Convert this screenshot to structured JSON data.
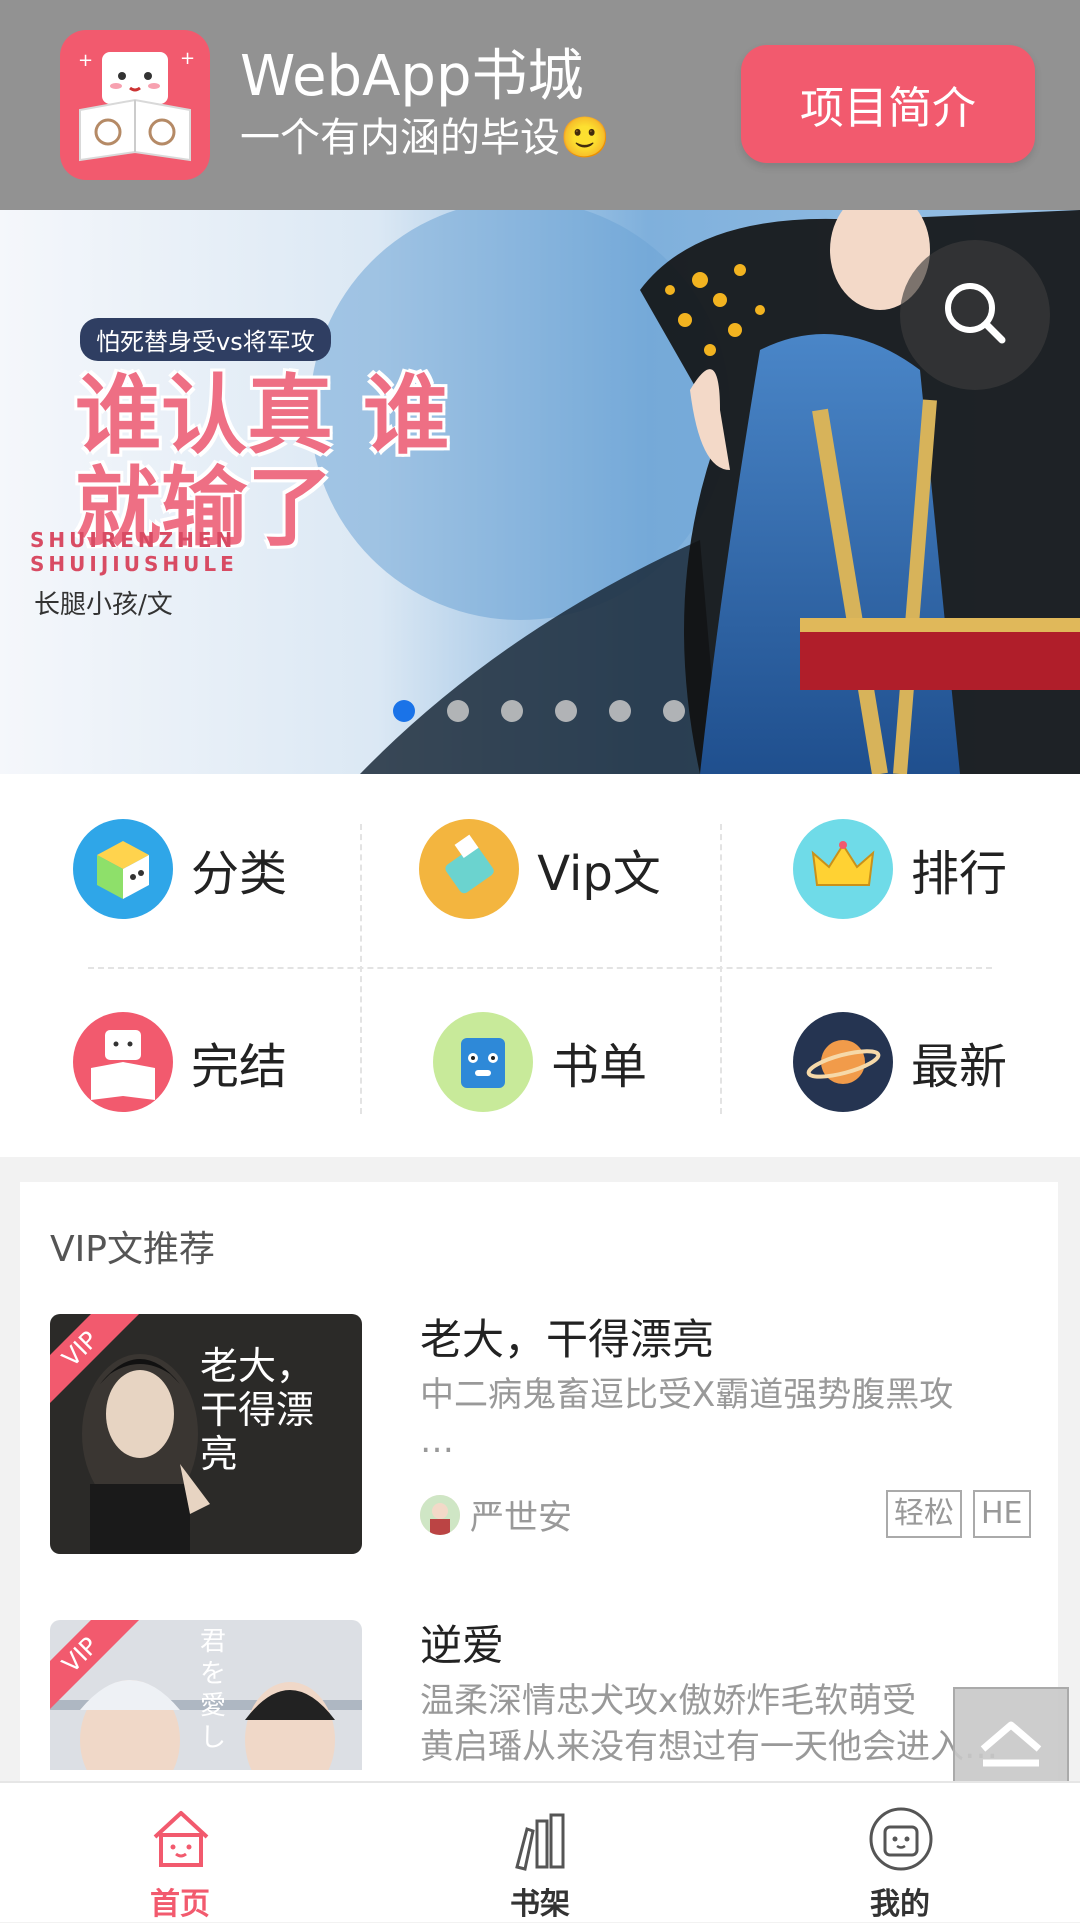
{
  "topbar": {
    "app_title": "WebApp书城",
    "app_subtitle": "一个有内涵的毕设🙂",
    "intro_button": "项目简介"
  },
  "banner": {
    "tag": "怕死替身受vs将军攻",
    "title": "谁认真 谁就输了",
    "pinyin": "SHUIRENZHEN SHUIJIUSHULE",
    "author": "长腿小孩/文",
    "slide_count": 6,
    "active_slide": 1
  },
  "categories": [
    {
      "label": "分类",
      "icon": "cube-icon"
    },
    {
      "label": "Vip文",
      "icon": "usb-drive-icon"
    },
    {
      "label": "排行",
      "icon": "crown-icon"
    },
    {
      "label": "完结",
      "icon": "bookstore-mascot-icon"
    },
    {
      "label": "书单",
      "icon": "blue-book-monster-icon"
    },
    {
      "label": "最新",
      "icon": "planet-icon"
    }
  ],
  "vip_section": {
    "title": "VIP文推荐",
    "vip_label": "VIP",
    "books": [
      {
        "title": "老大，干得漂亮",
        "desc": "中二病鬼畜逗比受X霸道强势腹黑攻",
        "desc_line2": "…",
        "author": "严世安",
        "tags": [
          "轻松",
          "HE"
        ],
        "cover_text": "老大，干得漂亮"
      },
      {
        "title": "逆爱",
        "desc": "温柔深情忠犬攻x傲娇炸毛软萌受",
        "desc_line2": "黄启璠从来没有想过有一天他会进入…",
        "cover_text": "君を愛し"
      }
    ]
  },
  "tabbar": {
    "items": [
      {
        "label": "首页",
        "icon": "home-icon",
        "active": true
      },
      {
        "label": "书架",
        "icon": "bookshelf-icon",
        "active": false
      },
      {
        "label": "我的",
        "icon": "profile-icon",
        "active": false
      }
    ]
  },
  "colors": {
    "accent": "#f25a6e",
    "topbar_bg": "#929292",
    "active_dot": "#1a73e8"
  }
}
